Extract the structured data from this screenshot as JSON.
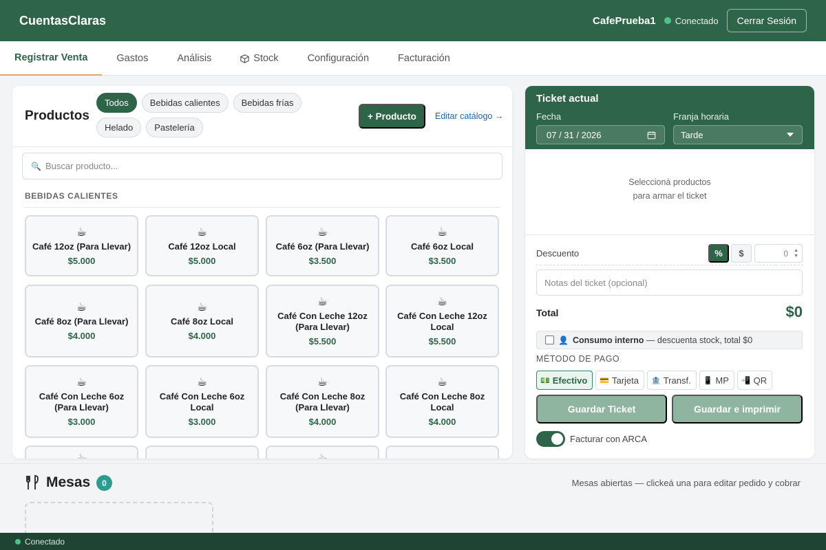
{
  "header": {
    "brand": "CuentasClaras",
    "user": "CafePrueba1",
    "status": "Conectado",
    "logout_label": "Cerrar Sesión"
  },
  "tabs": [
    {
      "label": "Registrar Venta",
      "icon": ""
    },
    {
      "label": "Gastos",
      "icon": ""
    },
    {
      "label": "Análisis",
      "icon": ""
    },
    {
      "label": "Stock",
      "icon": "box-icon"
    },
    {
      "label": "Configuración",
      "icon": ""
    },
    {
      "label": "Facturación",
      "icon": ""
    }
  ],
  "products": {
    "title": "Productos",
    "filters": [
      "Todos",
      "Bebidas calientes",
      "Bebidas frías",
      "Helado",
      "Pastelería"
    ],
    "active_filter": "Todos",
    "add_label": "+ Producto",
    "edit_label": "Editar catálogo →",
    "search_placeholder": "Buscar producto...",
    "section": "BEBIDAS CALIENTES",
    "items": [
      {
        "name": "Café 12oz (Para Llevar)",
        "price": "$5.000"
      },
      {
        "name": "Café 12oz Local",
        "price": "$5.000"
      },
      {
        "name": "Café 6oz (Para Llevar)",
        "price": "$3.500"
      },
      {
        "name": "Café 6oz Local",
        "price": "$3.500"
      },
      {
        "name": "Café 8oz (Para Llevar)",
        "price": "$4.000"
      },
      {
        "name": "Café 8oz Local",
        "price": "$4.000"
      },
      {
        "name": "Café Con Leche 12oz (Para Llevar)",
        "price": "$5.500"
      },
      {
        "name": "Café Con Leche 12oz Local",
        "price": "$5.500"
      },
      {
        "name": "Café Con Leche 6oz (Para Llevar)",
        "price": "$3.000"
      },
      {
        "name": "Café Con Leche 6oz Local",
        "price": "$3.000"
      },
      {
        "name": "Café Con Leche 8oz (Para Llevar)",
        "price": "$4.000"
      },
      {
        "name": "Café Con Leche 8oz Local",
        "price": "$4.000"
      }
    ]
  },
  "ticket": {
    "title": "Ticket actual",
    "date_label": "Fecha",
    "date_value": "07 / 31 / 2026",
    "slot_label": "Franja horaria",
    "slot_value": "Tarde",
    "empty_line1": "Seleccioná productos",
    "empty_line2": "para armar el ticket",
    "discount_label": "Descuento",
    "pct_label": "%",
    "usd_label": "$",
    "discount_value": "0",
    "notes_placeholder": "Notas del ticket (opcional)",
    "total_label": "Total",
    "total_value": "$0",
    "internal_bold": "Consumo interno",
    "internal_rest": " — descuenta stock, total $0",
    "payment_label": "MÉTODO DE PAGO",
    "payments": [
      {
        "label": "Efectivo",
        "icon": "cash-icon"
      },
      {
        "label": "Tarjeta",
        "icon": "card-icon"
      },
      {
        "label": "Transf.",
        "icon": "bank-icon"
      },
      {
        "label": "MP",
        "icon": "phone-icon"
      },
      {
        "label": "QR",
        "icon": "qr-phone-icon"
      }
    ],
    "active_payment": "Efectivo",
    "save_label": "Guardar Ticket",
    "save_print_label": "Guardar e imprimir",
    "arca_label": "Facturar con ARCA",
    "arca_on": true
  },
  "mesas": {
    "title": "Mesas",
    "count": "0",
    "hint": "Mesas abiertas — clickeá una para editar pedido y cobrar"
  },
  "statusbar": {
    "status": "Conectado"
  },
  "colors": {
    "brand": "#2e6448",
    "accent_tab": "#e3a36e",
    "price": "#2e6448",
    "badge": "#2a9d8f"
  }
}
